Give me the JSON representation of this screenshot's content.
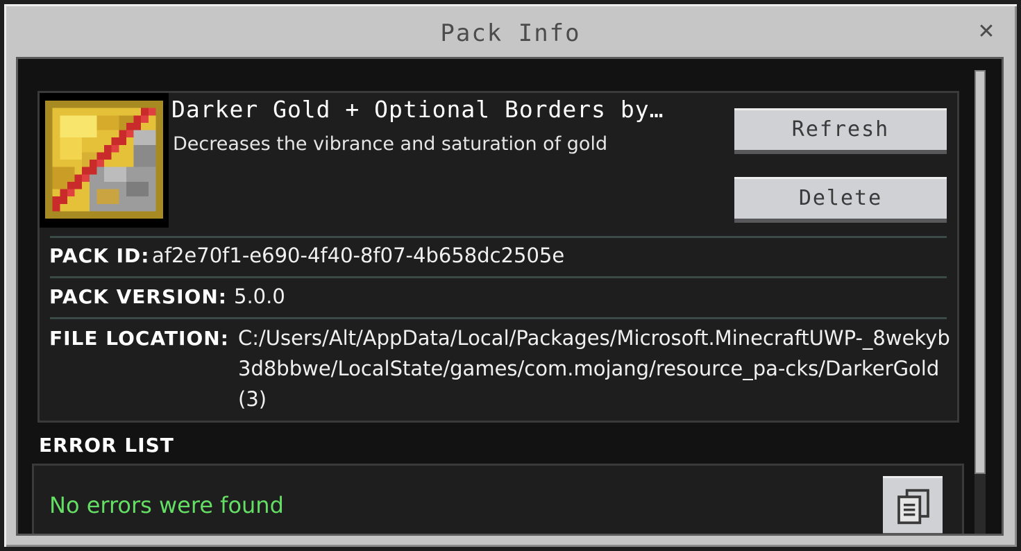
{
  "dialog": {
    "title": "Pack Info",
    "close_glyph": "✕"
  },
  "pack": {
    "name": "Darker Gold + Optional Borders by…",
    "description": "Decreases the vibrance and saturation of gold",
    "icon": "gold-ingot-pack-icon"
  },
  "buttons": {
    "refresh_label": "Refresh",
    "delete_label": "Delete"
  },
  "info": {
    "pack_id_label": "PACK ID:",
    "pack_id_value": "af2e70f1-e690-4f40-8f07-4b658dc2505e",
    "pack_version_label": "PACK VERSION:",
    "pack_version_value": "5.0.0",
    "file_location_label": "FILE LOCATION:",
    "file_location_value": "C:/Users/Alt/AppData/Local/Packages/Microsoft.MinecraftUWP-_8wekyb3d8bbwe/LocalState/games/com.mojang/resource_pa-cks/DarkerGold(3)"
  },
  "errors": {
    "title": "ERROR LIST",
    "message": "No errors were found",
    "message_color": "#64de64",
    "copy_icon": "clipboard-icon"
  },
  "colors": {
    "dialog_bg": "#c6c6c6",
    "content_bg": "#121212",
    "button_bg": "#d0d1d4"
  }
}
